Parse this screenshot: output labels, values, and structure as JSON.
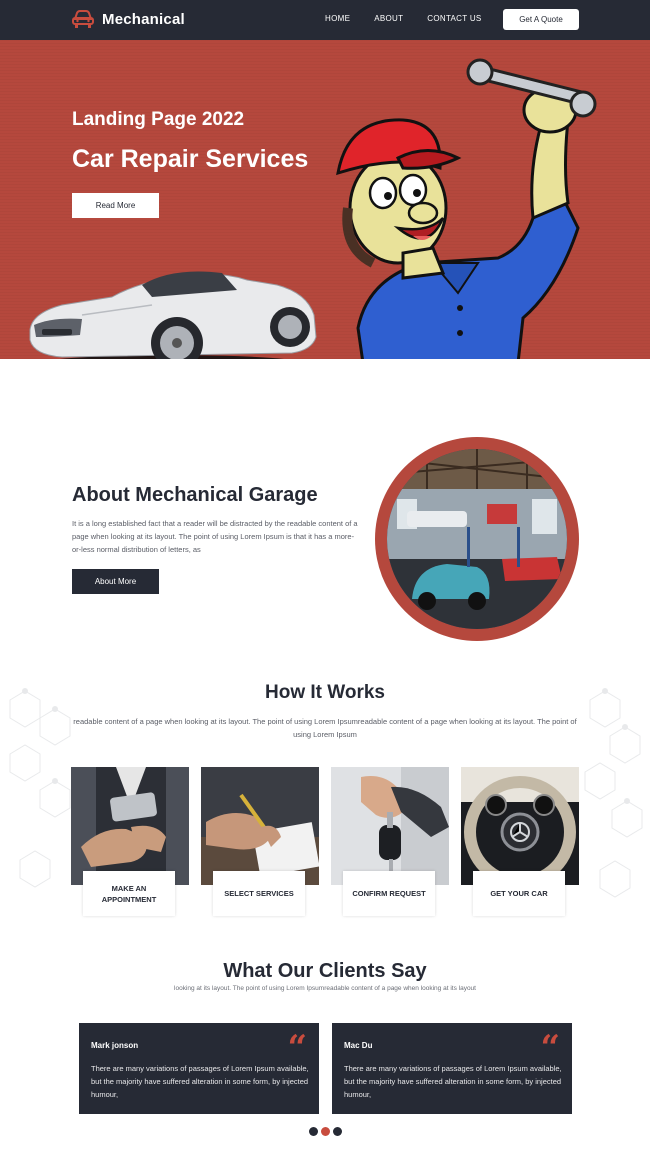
{
  "brand": {
    "name": "Mechanical",
    "accent": "#c84c3e",
    "dark": "#262a35",
    "hero_bg": "#b5483d"
  },
  "nav": {
    "links": [
      "HOME",
      "ABOUT",
      "CONTACT US"
    ],
    "quote_button": "Get A Quote"
  },
  "hero": {
    "subtitle": "Landing Page 2022",
    "title": "Car Repair Services",
    "button": "Read More"
  },
  "about": {
    "title": "About Mechanical Garage",
    "text": "It is a long established fact that a reader will be distracted by the readable content of a page when looking at its layout. The point of using Lorem Ipsum is that it has a more-or-less normal distribution of letters, as",
    "button": "About More"
  },
  "how": {
    "title": "How It Works",
    "text": "readable content of a page when looking at its layout. The point of using Lorem Ipsumreadable content of a page when looking at its layout. The point of using Lorem Ipsum",
    "steps": [
      {
        "label": "MAKE AN APPOINTMENT",
        "icon": "phone-in-hand-photo"
      },
      {
        "label": "SELECT SERVICES",
        "icon": "signing-document-photo"
      },
      {
        "label": "CONFIRM REQUEST",
        "icon": "car-keys-photo"
      },
      {
        "label": "GET YOUR CAR",
        "icon": "steering-wheel-photo"
      }
    ]
  },
  "clients": {
    "title": "What Our Clients Say",
    "text": "looking at its layout. The point of using Lorem Ipsumreadable content of a page when looking at its layout",
    "testimonials": [
      {
        "name": "Mark jonson",
        "quote_mark": "“",
        "text": "There are many variations of passages of Lorem Ipsum available, but the majority have suffered alteration in some form, by injected humour,"
      },
      {
        "name": "Mac Du",
        "quote_mark": "“",
        "text": "There are many variations of passages of Lorem Ipsum available, but the majority have suffered alteration in some form, by injected humour,"
      }
    ],
    "slider_active_index": 1
  }
}
